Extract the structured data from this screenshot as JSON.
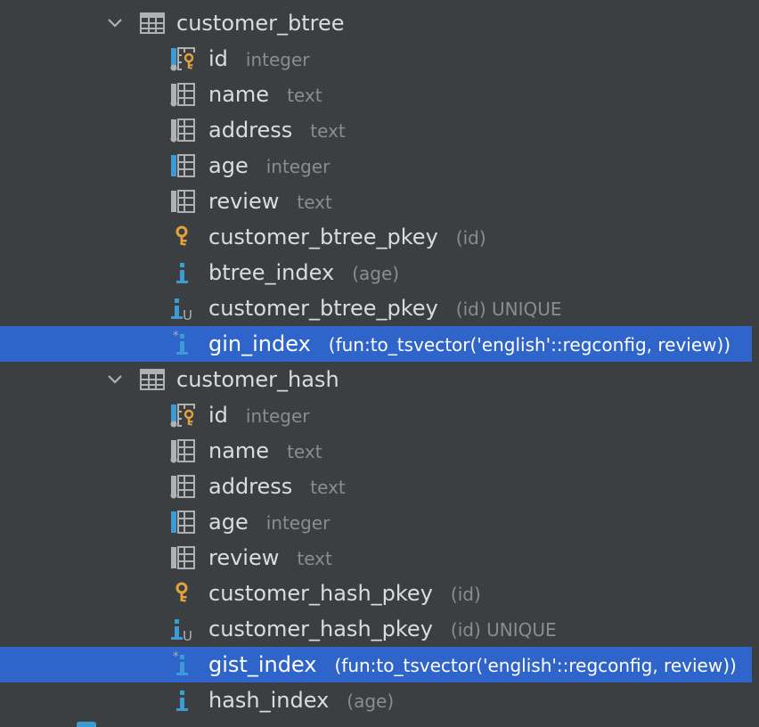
{
  "colors": {
    "background": "#3c3f41",
    "selection": "#2f65ca",
    "label": "#dcdcdc",
    "hint": "#8c8c8c",
    "icon_blue": "#3d9bd3",
    "icon_gray": "#afb1b3",
    "key_gold": "#e3a33a"
  },
  "tree": {
    "rows": [
      {
        "kind": "table",
        "icon": "table-icon",
        "label": "customer_btree",
        "hint": ""
      },
      {
        "kind": "child",
        "icon": "primary-key-column-icon",
        "label": "id",
        "hint": "integer"
      },
      {
        "kind": "child",
        "icon": "not-null-column-icon",
        "label": "name",
        "hint": "text"
      },
      {
        "kind": "child",
        "icon": "not-null-column-icon",
        "label": "address",
        "hint": "text"
      },
      {
        "kind": "child",
        "icon": "indexed-column-icon",
        "label": "age",
        "hint": "integer"
      },
      {
        "kind": "child",
        "icon": "column-icon",
        "label": "review",
        "hint": "text"
      },
      {
        "kind": "child",
        "icon": "key-icon",
        "label": "customer_btree_pkey",
        "hint": "(id)"
      },
      {
        "kind": "child",
        "icon": "index-icon",
        "label": "btree_index",
        "hint": "(age)"
      },
      {
        "kind": "child",
        "icon": "unique-index-icon",
        "label": "customer_btree_pkey",
        "hint": "(id) UNIQUE"
      },
      {
        "kind": "child",
        "icon": "functional-index-icon",
        "label": "gin_index",
        "hint": "(fun:to_tsvector('english'::regconfig, review))",
        "selected": true
      },
      {
        "kind": "table",
        "icon": "table-icon",
        "label": "customer_hash",
        "hint": ""
      },
      {
        "kind": "child",
        "icon": "primary-key-column-icon",
        "label": "id",
        "hint": "integer"
      },
      {
        "kind": "child",
        "icon": "not-null-column-icon",
        "label": "name",
        "hint": "text"
      },
      {
        "kind": "child",
        "icon": "not-null-column-icon",
        "label": "address",
        "hint": "text"
      },
      {
        "kind": "child",
        "icon": "indexed-column-icon",
        "label": "age",
        "hint": "integer"
      },
      {
        "kind": "child",
        "icon": "column-icon",
        "label": "review",
        "hint": "text"
      },
      {
        "kind": "child",
        "icon": "key-icon",
        "label": "customer_hash_pkey",
        "hint": "(id)"
      },
      {
        "kind": "child",
        "icon": "unique-index-icon",
        "label": "customer_hash_pkey",
        "hint": "(id) UNIQUE"
      },
      {
        "kind": "child",
        "icon": "functional-index-icon",
        "label": "gist_index",
        "hint": "(fun:to_tsvector('english'::regconfig, review))",
        "selected": true
      },
      {
        "kind": "child",
        "icon": "index-icon",
        "label": "hash_index",
        "hint": "(age)"
      }
    ]
  }
}
